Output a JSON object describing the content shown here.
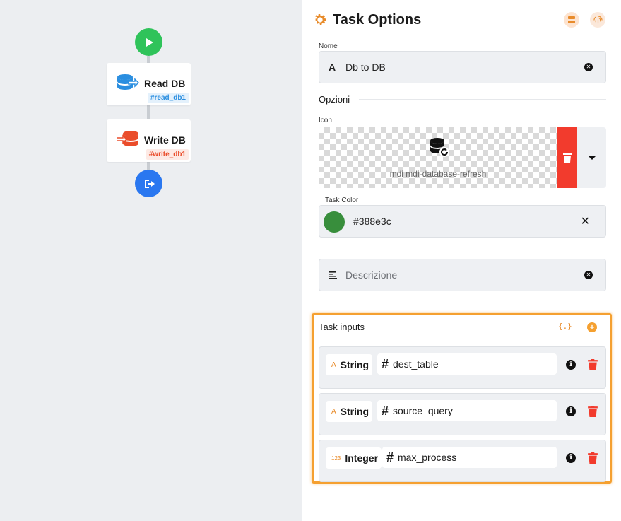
{
  "flow": {
    "start_label": "",
    "nodes": [
      {
        "label": "Read DB",
        "tag": "#read_db1",
        "color": "#2a8ee0"
      },
      {
        "label": "Write DB",
        "tag": "#write_db1",
        "color": "#ea4d2b"
      }
    ]
  },
  "panel": {
    "title": "Task Options",
    "name_label": "Nome",
    "name_value": "Db to DB",
    "options_heading": "Opzioni",
    "icon_label": "Icon",
    "icon_name": "mdi mdi-database-refresh",
    "color_label": "Task Color",
    "color_value": "#388e3c",
    "description_placeholder": "Descrizione"
  },
  "task_inputs": {
    "heading": "Task inputs",
    "json_button": "{.}",
    "items": [
      {
        "type": "String",
        "type_icon": "A",
        "name": "dest_table"
      },
      {
        "type": "String",
        "type_icon": "A",
        "name": "source_query"
      },
      {
        "type": "Integer",
        "type_icon": "123",
        "name": "max_process"
      }
    ]
  },
  "colors": {
    "accent": "#e88b2a",
    "start_node": "#2fc35a",
    "end_node": "#2a77f0",
    "delete": "#f23b2d",
    "highlight": "#f5a030"
  }
}
